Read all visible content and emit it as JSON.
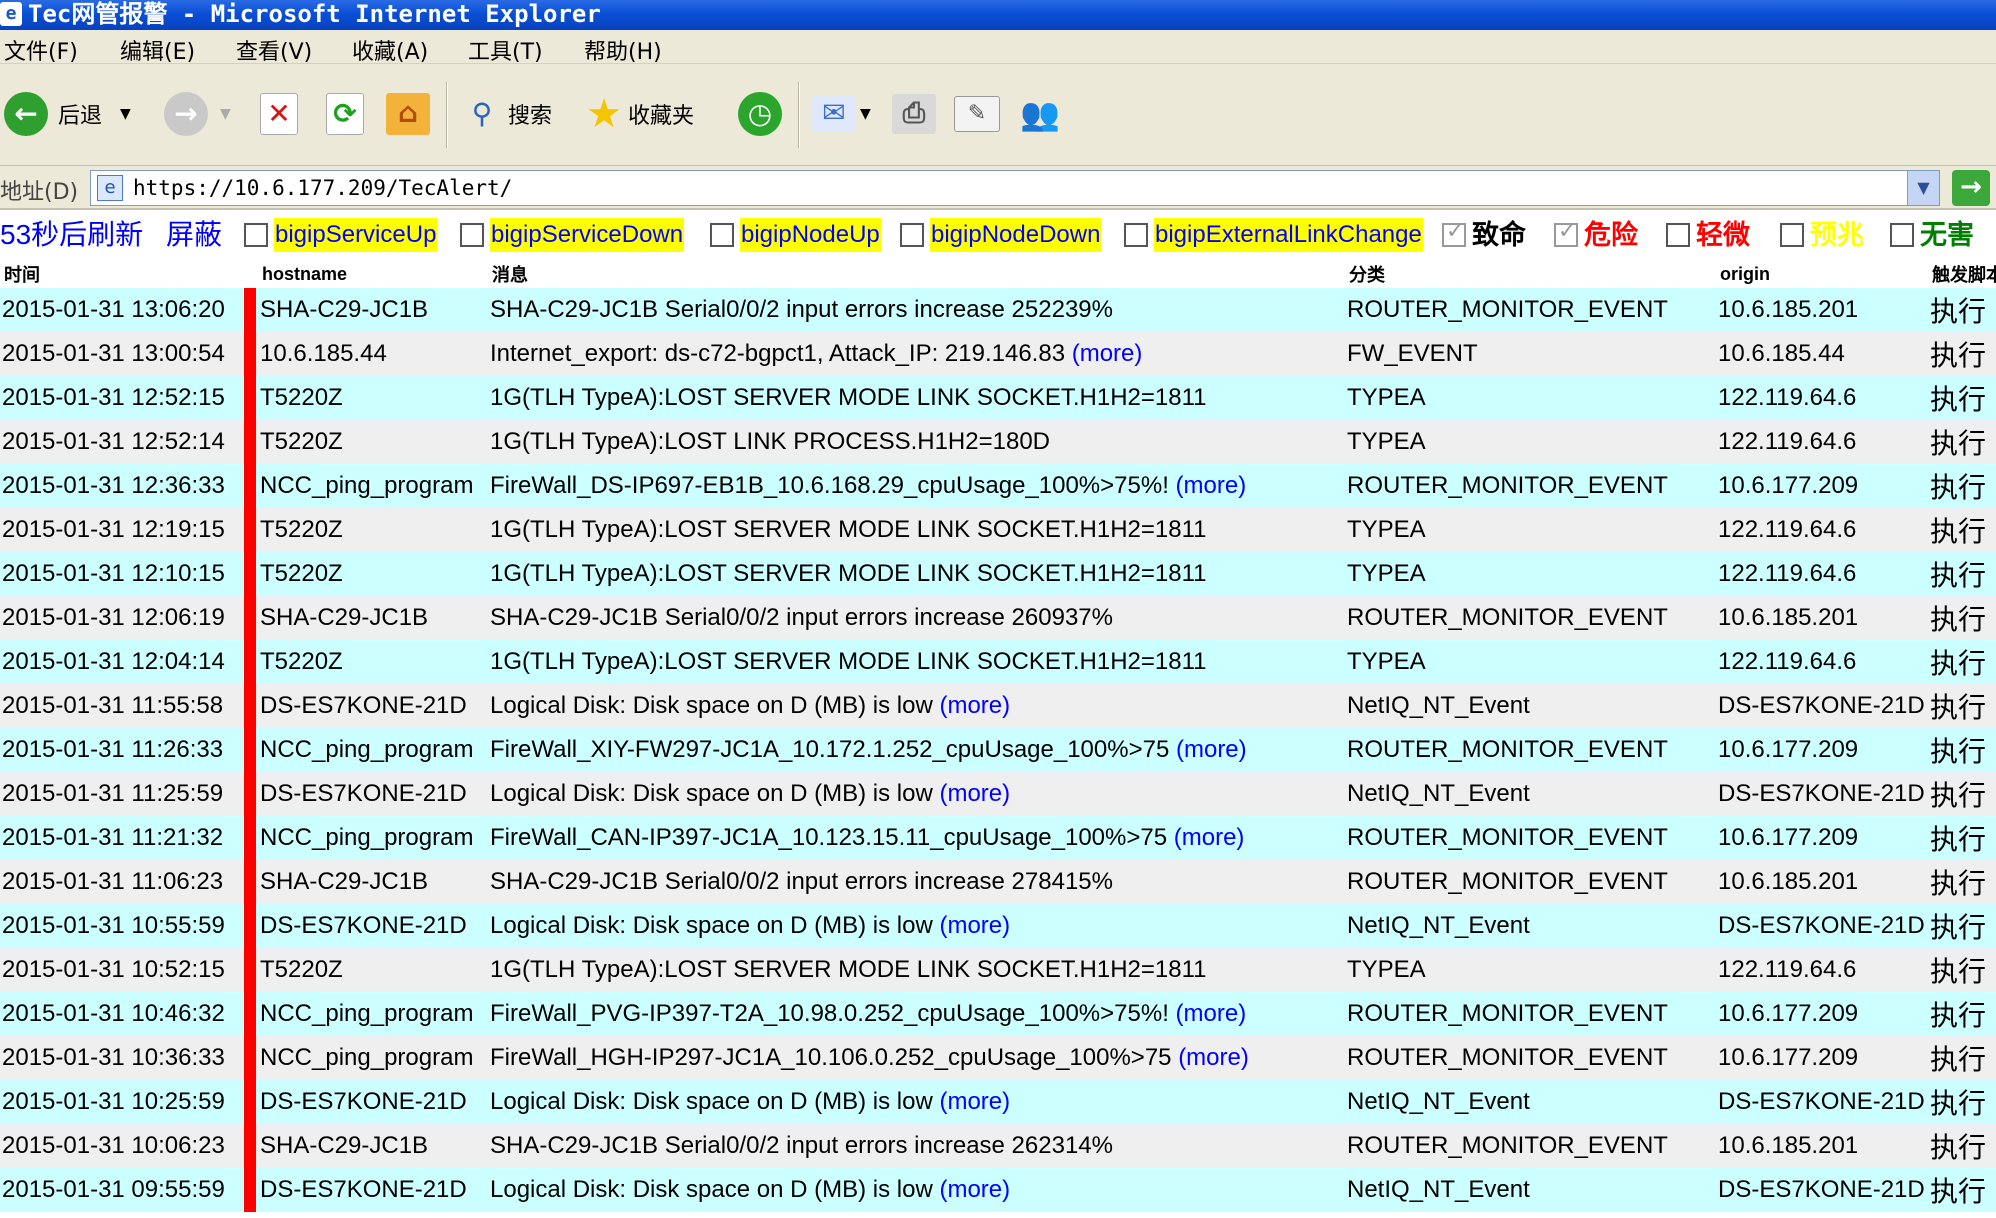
{
  "window": {
    "title": "Tec网管报警 - Microsoft Internet Explorer"
  },
  "menu": [
    "文件(F)",
    "编辑(E)",
    "查看(V)",
    "收藏(A)",
    "工具(T)",
    "帮助(H)"
  ],
  "toolbar": {
    "back_label": "后退",
    "search_label": "搜索",
    "favorites_label": "收藏夹"
  },
  "address": {
    "label": "地址(D)",
    "url": "https://10.6.177.209/TecAlert/"
  },
  "filters": {
    "refresh_label": "53秒后刷新",
    "mask_label": "屏蔽",
    "event_filters": [
      "bigipServiceUp",
      "bigipServiceDown",
      "bigipNodeUp",
      "bigipNodeDown",
      "bigipExternalLinkChange"
    ],
    "severities": [
      {
        "label": "致命",
        "checked": true,
        "color": "#000000"
      },
      {
        "label": "危险",
        "checked": true,
        "color": "#ff0000"
      },
      {
        "label": "轻微",
        "checked": false,
        "color": "#ff0000"
      },
      {
        "label": "预兆",
        "checked": false,
        "color": "#ffff00"
      },
      {
        "label": "无害",
        "checked": false,
        "color": "#008000"
      }
    ]
  },
  "table": {
    "headers": {
      "time": "时间",
      "hostname": "hostname",
      "message": "消息",
      "category": "分类",
      "origin": "origin",
      "action": "触发脚本"
    },
    "more_label": "(more)",
    "action_label": "执行",
    "severity_color": "#ff0000",
    "rows": [
      {
        "time": "2015-01-31 13:06:20",
        "hostname": "SHA-C29-JC1B",
        "message": "SHA-C29-JC1B Serial0/0/2 input errors increase 252239%",
        "more": false,
        "category": "ROUTER_MONITOR_EVENT",
        "origin": "10.6.185.201"
      },
      {
        "time": "2015-01-31 13:00:54",
        "hostname": "10.6.185.44",
        "message": "Internet_export: ds-c72-bgpct1, Attack_IP: 219.146.83",
        "more": true,
        "category": "FW_EVENT",
        "origin": "10.6.185.44"
      },
      {
        "time": "2015-01-31 12:52:15",
        "hostname": "T5220Z",
        "message": "1G(TLH TypeA):LOST SERVER MODE LINK SOCKET.H1H2=1811",
        "more": false,
        "category": "TYPEA",
        "origin": "122.119.64.6"
      },
      {
        "time": "2015-01-31 12:52:14",
        "hostname": "T5220Z",
        "message": "1G(TLH TypeA):LOST LINK PROCESS.H1H2=180D",
        "more": false,
        "category": "TYPEA",
        "origin": "122.119.64.6"
      },
      {
        "time": "2015-01-31 12:36:33",
        "hostname": "NCC_ping_program",
        "message": "FireWall_DS-IP697-EB1B_10.6.168.29_cpuUsage_100%>75%!",
        "more": true,
        "category": "ROUTER_MONITOR_EVENT",
        "origin": "10.6.177.209"
      },
      {
        "time": "2015-01-31 12:19:15",
        "hostname": "T5220Z",
        "message": "1G(TLH TypeA):LOST SERVER MODE LINK SOCKET.H1H2=1811",
        "more": false,
        "category": "TYPEA",
        "origin": "122.119.64.6"
      },
      {
        "time": "2015-01-31 12:10:15",
        "hostname": "T5220Z",
        "message": "1G(TLH TypeA):LOST SERVER MODE LINK SOCKET.H1H2=1811",
        "more": false,
        "category": "TYPEA",
        "origin": "122.119.64.6"
      },
      {
        "time": "2015-01-31 12:06:19",
        "hostname": "SHA-C29-JC1B",
        "message": "SHA-C29-JC1B Serial0/0/2 input errors increase 260937%",
        "more": false,
        "category": "ROUTER_MONITOR_EVENT",
        "origin": "10.6.185.201"
      },
      {
        "time": "2015-01-31 12:04:14",
        "hostname": "T5220Z",
        "message": "1G(TLH TypeA):LOST SERVER MODE LINK SOCKET.H1H2=1811",
        "more": false,
        "category": "TYPEA",
        "origin": "122.119.64.6"
      },
      {
        "time": "2015-01-31 11:55:58",
        "hostname": "DS-ES7KONE-21D",
        "message": "Logical Disk: Disk space on D (MB) is low",
        "more": true,
        "category": "NetIQ_NT_Event",
        "origin": "DS-ES7KONE-21D"
      },
      {
        "time": "2015-01-31 11:26:33",
        "hostname": "NCC_ping_program",
        "message": "FireWall_XIY-FW297-JC1A_10.172.1.252_cpuUsage_100%>75",
        "more": true,
        "category": "ROUTER_MONITOR_EVENT",
        "origin": "10.6.177.209"
      },
      {
        "time": "2015-01-31 11:25:59",
        "hostname": "DS-ES7KONE-21D",
        "message": "Logical Disk: Disk space on D (MB) is low",
        "more": true,
        "category": "NetIQ_NT_Event",
        "origin": "DS-ES7KONE-21D"
      },
      {
        "time": "2015-01-31 11:21:32",
        "hostname": "NCC_ping_program",
        "message": "FireWall_CAN-IP397-JC1A_10.123.15.11_cpuUsage_100%>75",
        "more": true,
        "category": "ROUTER_MONITOR_EVENT",
        "origin": "10.6.177.209"
      },
      {
        "time": "2015-01-31 11:06:23",
        "hostname": "SHA-C29-JC1B",
        "message": "SHA-C29-JC1B Serial0/0/2 input errors increase 278415%",
        "more": false,
        "category": "ROUTER_MONITOR_EVENT",
        "origin": "10.6.185.201"
      },
      {
        "time": "2015-01-31 10:55:59",
        "hostname": "DS-ES7KONE-21D",
        "message": "Logical Disk: Disk space on D (MB) is low",
        "more": true,
        "category": "NetIQ_NT_Event",
        "origin": "DS-ES7KONE-21D"
      },
      {
        "time": "2015-01-31 10:52:15",
        "hostname": "T5220Z",
        "message": "1G(TLH TypeA):LOST SERVER MODE LINK SOCKET.H1H2=1811",
        "more": false,
        "category": "TYPEA",
        "origin": "122.119.64.6"
      },
      {
        "time": "2015-01-31 10:46:32",
        "hostname": "NCC_ping_program",
        "message": "FireWall_PVG-IP397-T2A_10.98.0.252_cpuUsage_100%>75%!",
        "more": true,
        "category": "ROUTER_MONITOR_EVENT",
        "origin": "10.6.177.209"
      },
      {
        "time": "2015-01-31 10:36:33",
        "hostname": "NCC_ping_program",
        "message": "FireWall_HGH-IP297-JC1A_10.106.0.252_cpuUsage_100%>75",
        "more": true,
        "category": "ROUTER_MONITOR_EVENT",
        "origin": "10.6.177.209"
      },
      {
        "time": "2015-01-31 10:25:59",
        "hostname": "DS-ES7KONE-21D",
        "message": "Logical Disk: Disk space on D (MB) is low",
        "more": true,
        "category": "NetIQ_NT_Event",
        "origin": "DS-ES7KONE-21D"
      },
      {
        "time": "2015-01-31 10:06:23",
        "hostname": "SHA-C29-JC1B",
        "message": "SHA-C29-JC1B Serial0/0/2 input errors increase 262314%",
        "more": false,
        "category": "ROUTER_MONITOR_EVENT",
        "origin": "10.6.185.201"
      },
      {
        "time": "2015-01-31 09:55:59",
        "hostname": "DS-ES7KONE-21D",
        "message": "Logical Disk: Disk space on D (MB) is low",
        "more": true,
        "category": "NetIQ_NT_Event",
        "origin": "DS-ES7KONE-21D"
      }
    ]
  }
}
